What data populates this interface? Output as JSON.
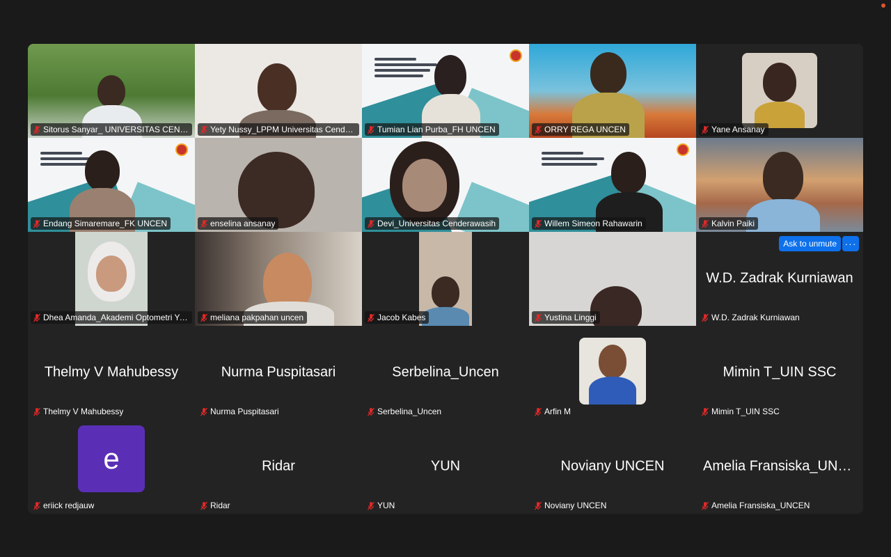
{
  "meeting": {
    "participants": [
      {
        "name": "Sitorus Sanyar_ UNIVERSITAS CENDERAWASIH",
        "type": "video",
        "muted": true
      },
      {
        "name": "Yety Nussy_LPPM Universitas Cenderawasih",
        "type": "video",
        "muted": true
      },
      {
        "name": "Tumian Lian Purba_FH UNCEN",
        "type": "video",
        "muted": true
      },
      {
        "name": "ORRY REGA UNCEN",
        "type": "video",
        "muted": true
      },
      {
        "name": "Yane Ansanay",
        "type": "photo",
        "muted": true
      },
      {
        "name": "Endang Simaremare_FK UNCEN",
        "type": "video",
        "muted": true
      },
      {
        "name": "enselina ansanay",
        "type": "video",
        "muted": true
      },
      {
        "name": "Devi_Universitas Cenderawasih",
        "type": "video",
        "muted": true
      },
      {
        "name": "Willem Simeon Rahawarin",
        "type": "video",
        "muted": true
      },
      {
        "name": "Kalvin Paiki",
        "type": "video",
        "muted": true
      },
      {
        "name": "Dhea Amanda_Akademi Optometri Yapenas",
        "type": "video",
        "muted": true
      },
      {
        "name": "meliana pakpahan uncen",
        "type": "video",
        "muted": true
      },
      {
        "name": "Jacob Kabes",
        "type": "video",
        "muted": true
      },
      {
        "name": "Yustina Linggi",
        "type": "video",
        "muted": true
      },
      {
        "name": "W.D. Zadrak Kurniawan",
        "type": "name",
        "display": "W.D. Zadrak Kurniawan",
        "muted": true
      },
      {
        "name": "Thelmy V Mahubessy",
        "type": "name",
        "display": "Thelmy V Mahubessy",
        "muted": true
      },
      {
        "name": "Nurma Puspitasari",
        "type": "name",
        "display": "Nurma Puspitasari",
        "muted": true
      },
      {
        "name": "Serbelina_Uncen",
        "type": "name",
        "display": "Serbelina_Uncen",
        "muted": true
      },
      {
        "name": "Arfin M",
        "type": "photo",
        "muted": true
      },
      {
        "name": "Mimin T_UIN SSC",
        "type": "name",
        "display": "Mimin T_UIN SSC",
        "muted": true
      },
      {
        "name": "eriick redjauw",
        "type": "letter",
        "letter": "e",
        "muted": true
      },
      {
        "name": "Ridar",
        "type": "name",
        "display": "Ridar",
        "muted": true
      },
      {
        "name": "YUN",
        "type": "name",
        "display": "YUN",
        "muted": true
      },
      {
        "name": "Noviany UNCEN",
        "type": "name",
        "display": "Noviany UNCEN",
        "muted": true
      },
      {
        "name": "Amelia Fransiska_UNCEN",
        "type": "name",
        "display": "Amelia Fransiska_UNCEN",
        "muted": true
      }
    ],
    "hover_controls": {
      "unmute_label": "Ask to unmute",
      "more_label": "···"
    }
  },
  "colors": {
    "background": "#1a1a1a",
    "tile": "#232323",
    "accent": "#0e71eb",
    "muted_icon": "#e02828",
    "avatar_purple": "#5a2fb6"
  }
}
